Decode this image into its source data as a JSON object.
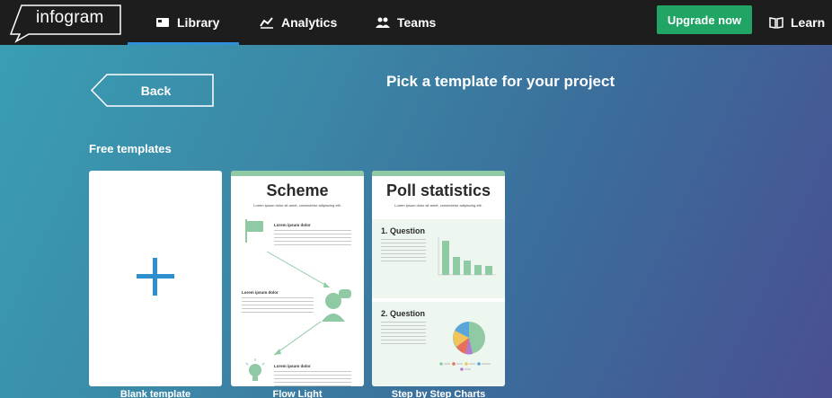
{
  "nav": {
    "logo": "infogram",
    "items": [
      {
        "label": "Library",
        "icon": "library-icon"
      },
      {
        "label": "Analytics",
        "icon": "analytics-icon"
      },
      {
        "label": "Teams",
        "icon": "teams-icon"
      }
    ],
    "upgrade_label": "Upgrade now",
    "learn_label": "Learn"
  },
  "page": {
    "back_label": "Back",
    "heading": "Pick a template for your project",
    "section_label": "Free templates"
  },
  "templates": [
    {
      "label": "Blank template"
    },
    {
      "label": "Flow Light",
      "title": "Scheme",
      "subtitle": "Lorem ipsum dolor sit amet, consectetur adipiscing elit.",
      "step_heading": "Lorem ipsum dolor"
    },
    {
      "label": "Step by Step Charts",
      "title": "Poll statistics",
      "subtitle": "Lorem ipsum dolor sit amet, consectetur adipiscing elit.",
      "q1": "1. Question",
      "q2": "2. Question"
    }
  ],
  "colors": {
    "nav_bg": "#1d1d1d",
    "accent_blue": "#2f8fd8",
    "upgrade_green": "#21a564",
    "template_green": "#8fcaa4"
  }
}
